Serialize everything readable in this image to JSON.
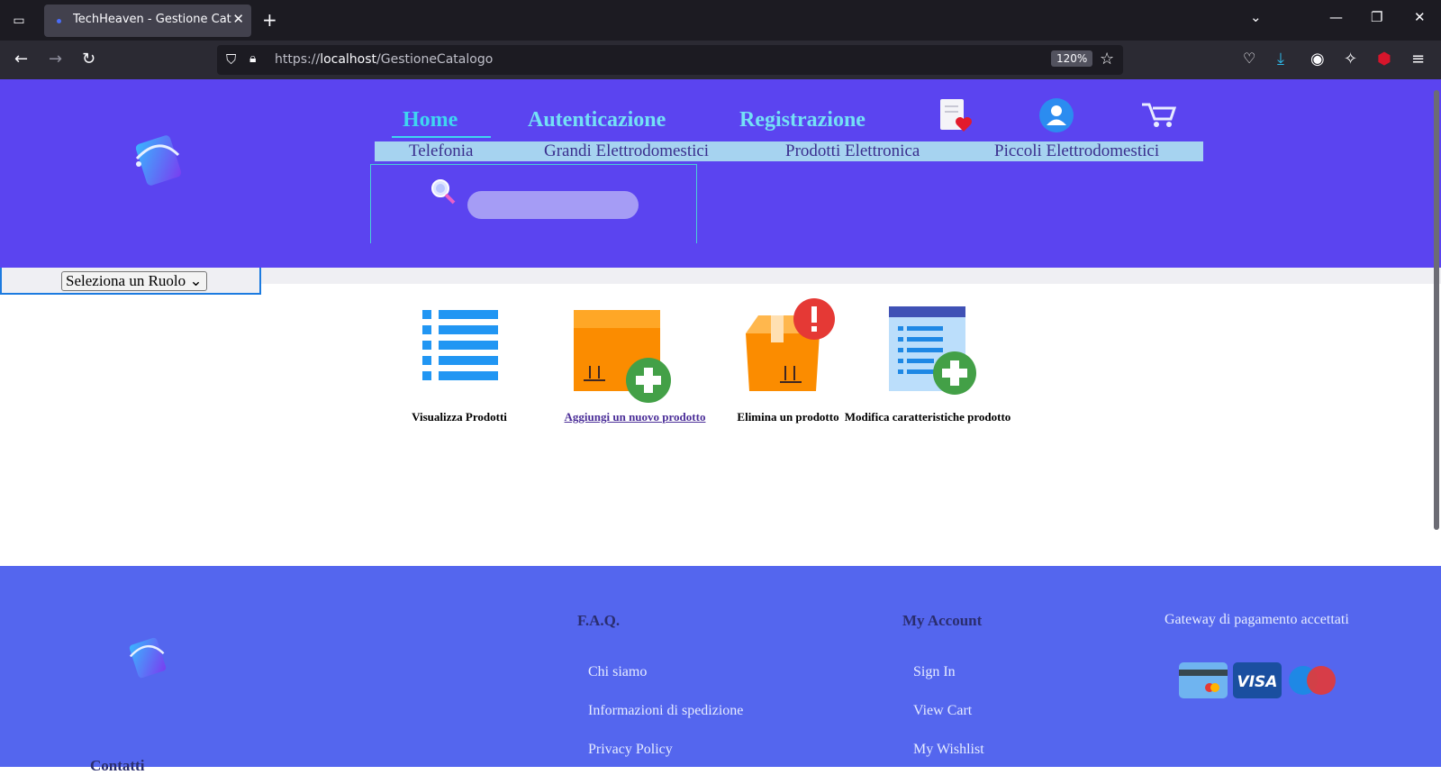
{
  "browser": {
    "tab_title": "TechHeaven - Gestione Catalogo",
    "tab_close": "✕",
    "new_tab": "+",
    "url_prefix": "https://",
    "url_host": "localhost",
    "url_path": "/GestioneCatalogo",
    "zoom": "120%"
  },
  "header": {
    "nav": {
      "home": "Home",
      "auth": "Autenticazione",
      "register": "Registrazione"
    },
    "categories": [
      "Telefonia",
      "Grandi Elettrodomestici",
      "Prodotti Elettronica",
      "Piccoli Elettrodomestici"
    ],
    "role_select": "Seleziona un Ruolo"
  },
  "actions": [
    {
      "label": "Visualizza Prodotti"
    },
    {
      "label": "Aggiungi un nuovo prodotto"
    },
    {
      "label": "Elimina un prodotto"
    },
    {
      "label": "Modifica caratteristiche prodotto"
    }
  ],
  "footer": {
    "faq_title": "F.A.Q.",
    "faq_links": [
      "Chi siamo",
      "Informazioni di spedizione",
      "Privacy Policy"
    ],
    "account_title": "My Account",
    "account_links": [
      "Sign In",
      "View Cart",
      "My Wishlist"
    ],
    "payment_title": "Gateway di pagamento accettati",
    "contacts_title": "Contatti"
  },
  "colors": {
    "header_bg": "#5b44f0",
    "nav_text": "#74e0f5",
    "category_bar": "#a6d3f0",
    "footer_bg": "#5466ee"
  }
}
